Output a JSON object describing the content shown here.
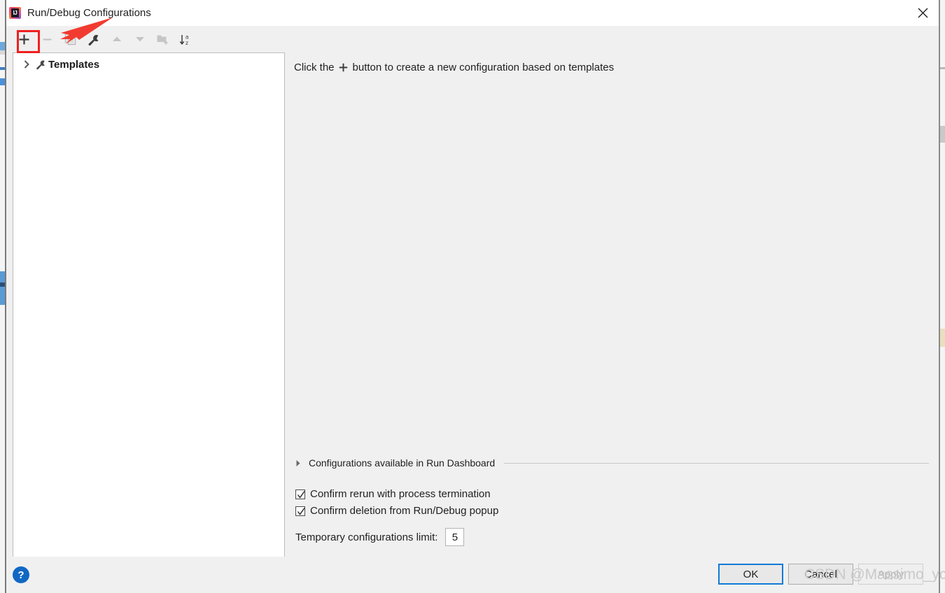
{
  "window": {
    "title": "Run/Debug Configurations",
    "app_icon": "intellij-idea-icon",
    "close_label": "✕"
  },
  "toolbar": {
    "buttons": [
      {
        "name": "add-configuration-button",
        "icon": "plus-icon",
        "label": "+",
        "enabled": true,
        "highlighted": true
      },
      {
        "name": "remove-configuration-button",
        "icon": "minus-icon",
        "label": "−",
        "enabled": false,
        "highlighted": false
      },
      {
        "name": "copy-configuration-button",
        "icon": "copy-icon",
        "label": "Copy Configuration",
        "enabled": false,
        "highlighted": false
      },
      {
        "name": "edit-templates-button",
        "icon": "wrench-icon",
        "label": "Edit Templates",
        "enabled": true,
        "highlighted": false
      },
      {
        "name": "move-up-button",
        "icon": "arrow-up-icon",
        "label": "Move Up",
        "enabled": false,
        "highlighted": false
      },
      {
        "name": "move-down-button",
        "icon": "arrow-down-icon",
        "label": "Move Down",
        "enabled": false,
        "highlighted": false
      },
      {
        "name": "new-folder-button",
        "icon": "folder-plus-icon",
        "label": "Create New Folder",
        "enabled": false,
        "highlighted": false
      },
      {
        "name": "sort-button",
        "icon": "sort-az-icon",
        "label": "Sort Configurations",
        "enabled": true,
        "highlighted": false
      }
    ]
  },
  "annotation": {
    "box_color": "#f02020",
    "arrow_color": "#f23b30",
    "target": "add-configuration-button"
  },
  "tree": {
    "items": [
      {
        "label": "Templates",
        "icon": "wrench-icon",
        "chevron": "❯",
        "expanded": false,
        "bold": true
      }
    ]
  },
  "main": {
    "hint_prefix": "Click the",
    "hint_icon": "plus-icon",
    "hint_suffix": "button to create a new configuration based on templates",
    "dashboard_section": {
      "label": "Configurations available in Run Dashboard",
      "expanded": false,
      "triangle_icon": "triangle-right-icon"
    },
    "checkboxes": [
      {
        "name": "confirm-rerun-checkbox",
        "label": "Confirm rerun with process termination",
        "checked": true
      },
      {
        "name": "confirm-deletion-checkbox",
        "label": "Confirm deletion from Run/Debug popup",
        "checked": true
      }
    ],
    "temporary_limit": {
      "label": "Temporary configurations limit:",
      "value": "5"
    }
  },
  "footer": {
    "help_label": "?",
    "buttons": [
      {
        "name": "ok-button",
        "label": "OK",
        "enabled": true,
        "primary": true
      },
      {
        "name": "cancel-button",
        "label": "Cancel",
        "enabled": true,
        "primary": false
      },
      {
        "name": "apply-button",
        "label": "Apply",
        "enabled": false,
        "primary": false
      }
    ]
  },
  "watermark": {
    "text": "CSDN @Massimo_ycw"
  },
  "colors": {
    "accent": "#0f7ad6",
    "help_blue": "#1068c4",
    "annotation_red": "#f02020",
    "dialog_bg": "#f0f0f0",
    "panel_bg": "#ffffff"
  }
}
